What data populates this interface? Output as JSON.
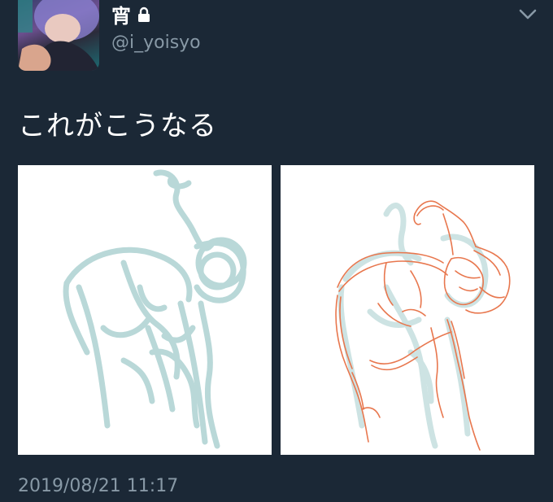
{
  "tweet": {
    "author": {
      "display_name": "宵",
      "handle": "@i_yoisyo",
      "protected": true,
      "avatar_icon": "user-avatar"
    },
    "text": "これがこうなる",
    "timestamp": "2019/08/21 11:17",
    "media_count": 2,
    "menu_icon": "chevron-down-icon"
  },
  "colors": {
    "background": "#1b2836",
    "secondary_text": "#8899a6",
    "sketch_blue": "#b9d8d8",
    "sketch_orange": "#e8774e"
  }
}
